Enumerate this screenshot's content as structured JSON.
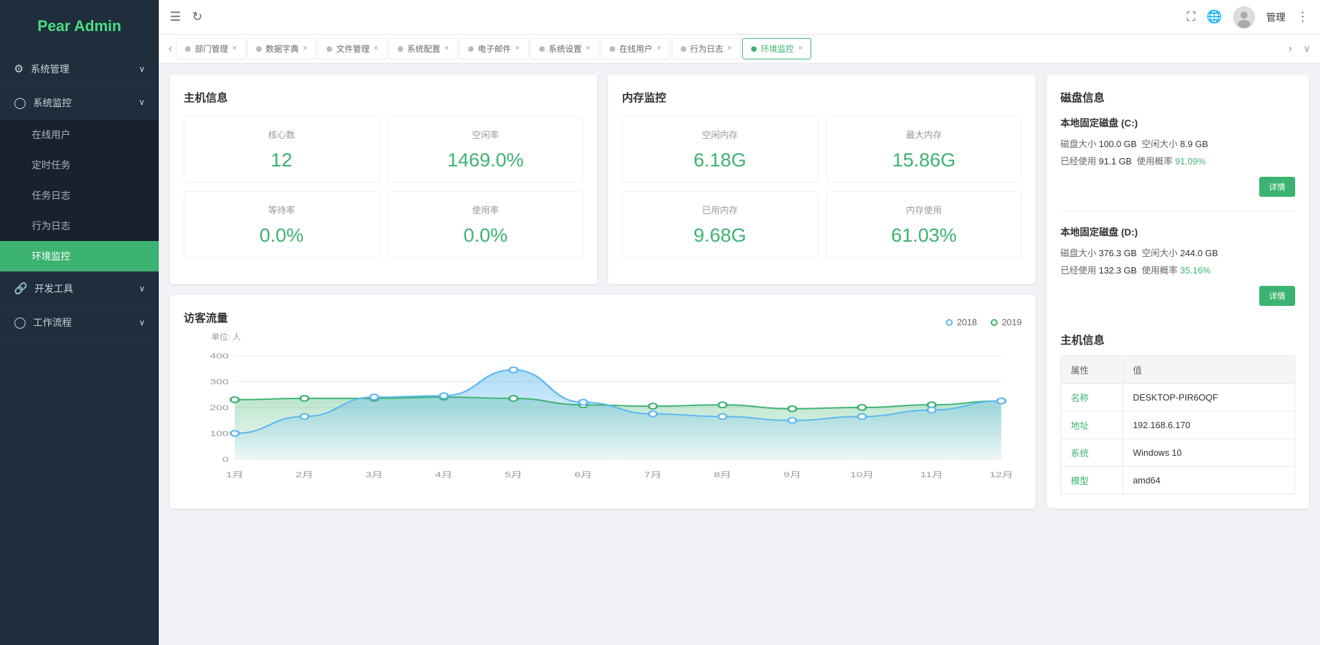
{
  "sidebar": {
    "logo": "Pear Admin",
    "groups": [
      {
        "id": "system-manage",
        "label": "系统管理",
        "icon": "⚙",
        "expanded": false,
        "items": []
      },
      {
        "id": "system-monitor",
        "label": "系统监控",
        "icon": "◯",
        "expanded": true,
        "items": [
          {
            "id": "online-users",
            "label": "在线用户",
            "active": false
          },
          {
            "id": "scheduled-tasks",
            "label": "定时任务",
            "active": false
          },
          {
            "id": "task-log",
            "label": "任务日志",
            "active": false
          },
          {
            "id": "behavior-log",
            "label": "行为日志",
            "active": false
          },
          {
            "id": "env-monitor",
            "label": "环境监控",
            "active": true
          }
        ]
      },
      {
        "id": "dev-tools",
        "label": "开发工具",
        "icon": "🔗",
        "expanded": false,
        "items": []
      },
      {
        "id": "workflow",
        "label": "工作流程",
        "icon": "◯",
        "expanded": false,
        "items": []
      }
    ]
  },
  "header": {
    "menu_icon": "☰",
    "refresh_icon": "↻",
    "fullscreen_icon": "⛶",
    "globe_icon": "🌐",
    "user_name": "管理",
    "more_icon": "⋮"
  },
  "tabs": {
    "prev_btn": "‹",
    "next_btn": "›",
    "expand_btn": "∨",
    "items": [
      {
        "label": "部门管理",
        "active": false
      },
      {
        "label": "数据字典",
        "active": false
      },
      {
        "label": "文件管理",
        "active": false
      },
      {
        "label": "系统配置",
        "active": false
      },
      {
        "label": "电子邮件",
        "active": false
      },
      {
        "label": "系统设置",
        "active": false
      },
      {
        "label": "在线用户",
        "active": false
      },
      {
        "label": "行为日志",
        "active": false
      },
      {
        "label": "环境监控",
        "active": true
      }
    ]
  },
  "host_info": {
    "title": "主机信息",
    "metrics": [
      {
        "label": "核心数",
        "value": "12"
      },
      {
        "label": "空闲率",
        "value": "1469.0%"
      },
      {
        "label": "等待率",
        "value": "0.0%"
      },
      {
        "label": "使用率",
        "value": "0.0%"
      }
    ]
  },
  "memory": {
    "title": "内存监控",
    "metrics": [
      {
        "label": "空闲内存",
        "value": "6.18G"
      },
      {
        "label": "最大内存",
        "value": "15.86G"
      },
      {
        "label": "已用内存",
        "value": "9.68G"
      },
      {
        "label": "内存使用",
        "value": "61.03%"
      }
    ]
  },
  "disk": {
    "title": "磁盘信息",
    "sections": [
      {
        "name": "本地固定磁盘 (C:)",
        "size_label": "磁盘大小",
        "size_value": "100.0 GB",
        "free_label": "空闲大小",
        "free_value": "8.9 GB",
        "used_label": "已经使用",
        "used_value": "91.1 GB",
        "usage_label": "使用概率",
        "usage_value": "91.09%",
        "detail_btn": "详情"
      },
      {
        "name": "本地固定磁盘 (D:)",
        "size_label": "磁盘大小",
        "size_value": "376.3 GB",
        "free_label": "空闲大小",
        "free_value": "244.0 GB",
        "used_label": "已经使用",
        "used_value": "132.3 GB",
        "usage_label": "使用概率",
        "usage_value": "35.16%",
        "detail_btn": "详情"
      }
    ],
    "host_info": {
      "title": "主机信息",
      "columns": [
        "属性",
        "值"
      ],
      "rows": [
        {
          "key": "名称",
          "value": "DESKTOP-PIR6OQF"
        },
        {
          "key": "地址",
          "value": "192.168.6.170"
        },
        {
          "key": "系统",
          "value": "Windows 10"
        },
        {
          "key": "模型",
          "value": "amd64"
        }
      ]
    }
  },
  "traffic": {
    "title": "访客流量",
    "legend": {
      "year1": "2018",
      "year2": "2019"
    },
    "chart": {
      "unit": "单位: 人",
      "y_labels": [
        "400",
        "300",
        "200",
        "100",
        "0"
      ],
      "x_labels": [
        "1月",
        "2月",
        "3月",
        "4月",
        "5月",
        "6月",
        "7月",
        "8月",
        "9月",
        "10月",
        "11月",
        "12月"
      ],
      "series_2018": [
        100,
        165,
        240,
        245,
        345,
        220,
        175,
        165,
        150,
        165,
        190,
        225
      ],
      "series_2019": [
        230,
        235,
        235,
        240,
        235,
        210,
        205,
        210,
        195,
        200,
        210,
        225
      ]
    }
  }
}
